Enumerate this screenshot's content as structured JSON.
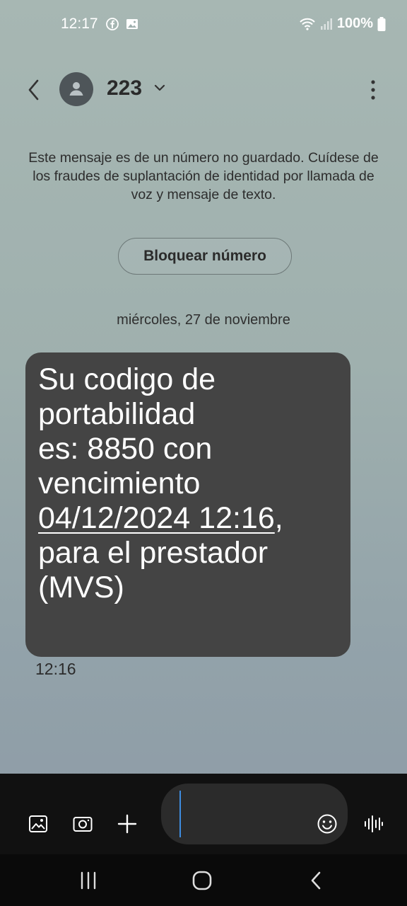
{
  "status": {
    "time": "12:17",
    "battery": "100%"
  },
  "header": {
    "contact_name": "223"
  },
  "warning": {
    "text": "Este mensaje es de un número no guardado. Cuídese de los fraudes de suplantación de identidad por llamada de voz y mensaje de texto.",
    "block_button": "Bloquear número"
  },
  "conversation": {
    "date": "miércoles, 27 de noviembre",
    "message": {
      "line1": "Su codigo de",
      "line2": "portabilidad",
      "line3": "es: 8850 con",
      "line4": "vencimiento",
      "link": "04/12/2024 12:16",
      "link_after": ",",
      "line6": "para el prestador",
      "line7": "(MVS)",
      "time": "12:16"
    }
  },
  "icons": {
    "status": [
      "facebook-icon",
      "image-icon",
      "wifi-icon",
      "signal-icon",
      "battery-icon"
    ],
    "header": [
      "back-icon",
      "avatar-icon",
      "chevron-down-icon",
      "more-icon"
    ],
    "composer": [
      "gallery-icon",
      "camera-icon",
      "plus-icon",
      "emoji-icon",
      "voice-icon"
    ],
    "navbar": [
      "recent-apps-icon",
      "home-icon",
      "back-nav-icon"
    ]
  }
}
